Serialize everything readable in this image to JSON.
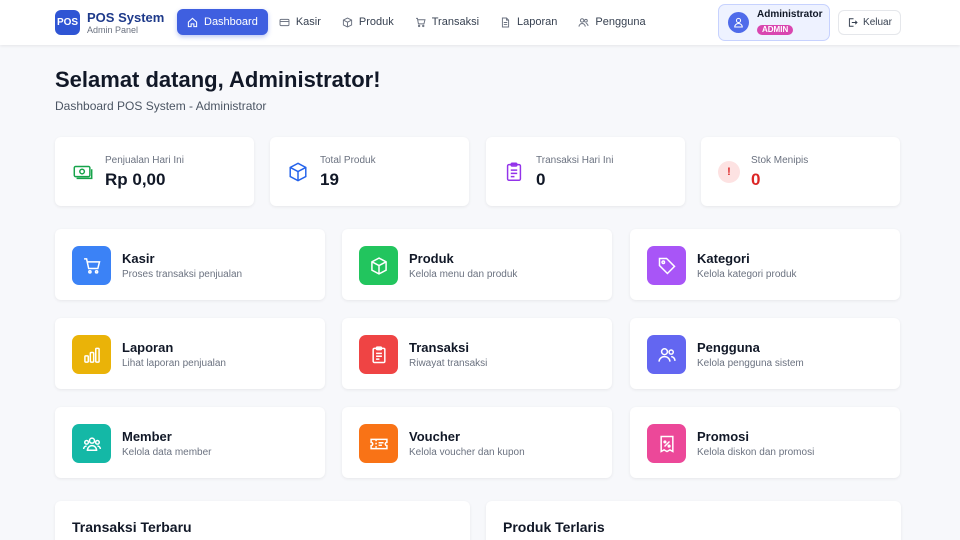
{
  "brand": {
    "logo": "POS",
    "title": "POS System",
    "subtitle": "Admin Panel"
  },
  "nav": [
    {
      "label": "Dashboard",
      "icon": "home-icon",
      "active": true
    },
    {
      "label": "Kasir",
      "icon": "card-icon"
    },
    {
      "label": "Produk",
      "icon": "box-icon"
    },
    {
      "label": "Transaksi",
      "icon": "cart-icon"
    },
    {
      "label": "Laporan",
      "icon": "document-icon"
    },
    {
      "label": "Pengguna",
      "icon": "users-icon"
    }
  ],
  "user": {
    "name": "Administrator",
    "role": "ADMIN"
  },
  "logout": {
    "label": "Keluar"
  },
  "header": {
    "title": "Selamat datang, Administrator!",
    "subtitle": "Dashboard POS System - Administrator"
  },
  "stats": [
    {
      "label": "Penjualan Hari Ini",
      "value": "Rp 0,00",
      "icon": "money-icon",
      "color": "#16a34a"
    },
    {
      "label": "Total Produk",
      "value": "19",
      "icon": "cube-icon",
      "color": "#2563eb"
    },
    {
      "label": "Transaksi Hari Ini",
      "value": "0",
      "icon": "clipboard-icon",
      "color": "#9333ea"
    },
    {
      "label": "Stok Menipis",
      "value": "0",
      "icon": "alert-icon",
      "alert_symbol": "!",
      "color": "#dc2626"
    }
  ],
  "tiles": [
    {
      "title": "Kasir",
      "desc": "Proses transaksi penjualan",
      "icon": "cart-icon",
      "color": "#3b82f6"
    },
    {
      "title": "Produk",
      "desc": "Kelola menu dan produk",
      "icon": "cube-icon",
      "color": "#22c55e"
    },
    {
      "title": "Kategori",
      "desc": "Kelola kategori produk",
      "icon": "tag-icon",
      "color": "#a855f7"
    },
    {
      "title": "Laporan",
      "desc": "Lihat laporan penjualan",
      "icon": "bar-chart-icon",
      "color": "#eab308"
    },
    {
      "title": "Transaksi",
      "desc": "Riwayat transaksi",
      "icon": "receipt-icon",
      "color": "#ef4444"
    },
    {
      "title": "Pengguna",
      "desc": "Kelola pengguna sistem",
      "icon": "users-icon",
      "color": "#6366f1"
    },
    {
      "title": "Member",
      "desc": "Kelola data member",
      "icon": "group-icon",
      "color": "#14b8a6"
    },
    {
      "title": "Voucher",
      "desc": "Kelola voucher dan kupon",
      "icon": "ticket-icon",
      "color": "#f97316"
    },
    {
      "title": "Promosi",
      "desc": "Kelola diskon dan promosi",
      "icon": "percent-tag-icon",
      "color": "#ec4899"
    }
  ],
  "panels": [
    {
      "title": "Transaksi Terbaru"
    },
    {
      "title": "Produk Terlaris"
    }
  ]
}
